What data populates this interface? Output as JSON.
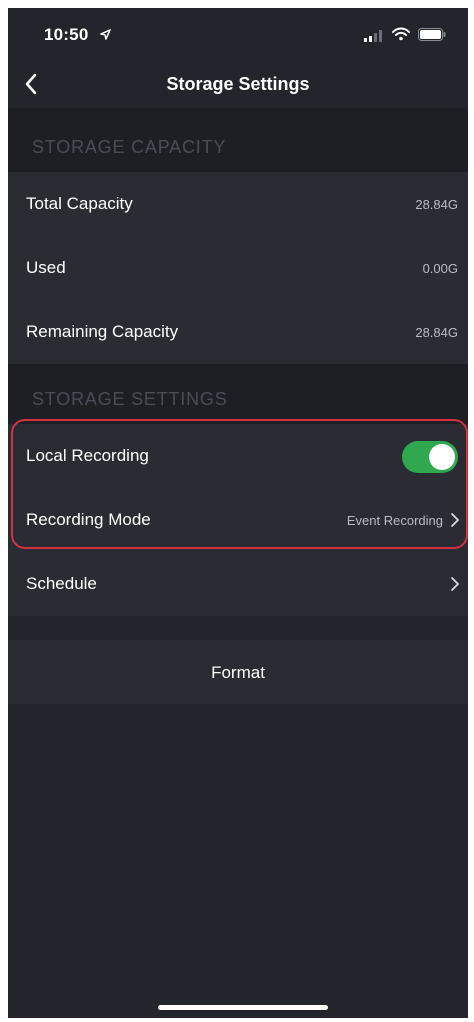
{
  "status_bar": {
    "time": "10:50",
    "icons": [
      "location-arrow-icon",
      "cellular-signal-icon",
      "wifi-icon",
      "battery-icon"
    ]
  },
  "nav": {
    "title": "Storage Settings",
    "back_icon": "chevron-left-icon"
  },
  "storage_capacity": {
    "header": "STORAGE CAPACITY",
    "rows": [
      {
        "label": "Total Capacity",
        "value": "28.84G"
      },
      {
        "label": "Used",
        "value": "0.00G"
      },
      {
        "label": "Remaining Capacity",
        "value": "28.84G"
      }
    ]
  },
  "storage_settings": {
    "header": "STORAGE SETTINGS",
    "local_recording": {
      "label": "Local Recording",
      "enabled": true
    },
    "recording_mode": {
      "label": "Recording Mode",
      "value": "Event Recording"
    },
    "schedule": {
      "label": "Schedule"
    }
  },
  "format_label": "Format",
  "colors": {
    "background": "#23252c",
    "row_background": "#2a2c34",
    "toggle_on": "#2fa84f",
    "highlight": "#d6313c"
  }
}
